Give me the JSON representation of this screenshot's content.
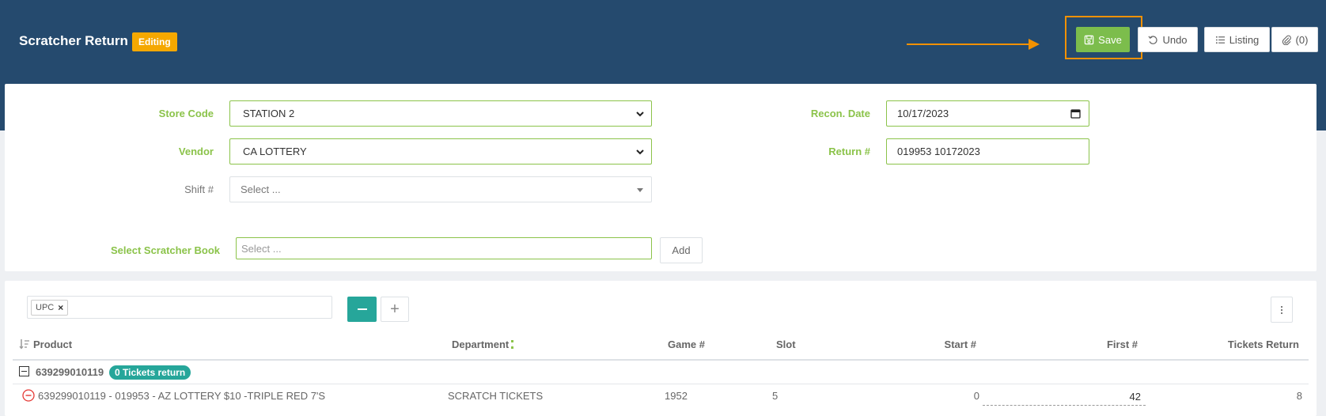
{
  "header": {
    "title": "Scratcher Return",
    "status_badge": "Editing",
    "buttons": {
      "save": "Save",
      "undo": "Undo",
      "listing": "Listing",
      "attachments": "(0)"
    },
    "annotation_color": "#f29100"
  },
  "form": {
    "store_code": {
      "label": "Store Code",
      "value": "STATION 2"
    },
    "vendor": {
      "label": "Vendor",
      "value": "CA LOTTERY"
    },
    "shift": {
      "label": "Shift #",
      "placeholder": "Select ..."
    },
    "recon_date": {
      "label": "Recon. Date",
      "value": "10/17/2023"
    },
    "return_no": {
      "label": "Return #",
      "value": "019953 10172023"
    },
    "scratcher_book": {
      "label": "Select Scratcher Book",
      "placeholder": "Select ...",
      "add_label": "Add"
    }
  },
  "grid": {
    "group_tags": [
      "UPC"
    ],
    "columns": {
      "product": "Product",
      "department": "Department",
      "game": "Game #",
      "slot": "Slot",
      "start": "Start #",
      "first": "First #",
      "tickets_return": "Tickets Return"
    },
    "groups": [
      {
        "label": "639299010119",
        "badge": "0 Tickets return",
        "rows": [
          {
            "product": "639299010119 - 019953 - AZ LOTTERY $10 -TRIPLE RED 7'S",
            "department": "SCRATCH TICKETS",
            "game": "1952",
            "slot": "5",
            "start": "0",
            "first": "42",
            "tickets_return": "8"
          }
        ]
      }
    ]
  },
  "colors": {
    "header_bg": "#254a6e",
    "save_green": "#7cbd4c",
    "label_green": "#8bc34a",
    "teal": "#26a69a",
    "badge_orange": "#f5a800"
  }
}
